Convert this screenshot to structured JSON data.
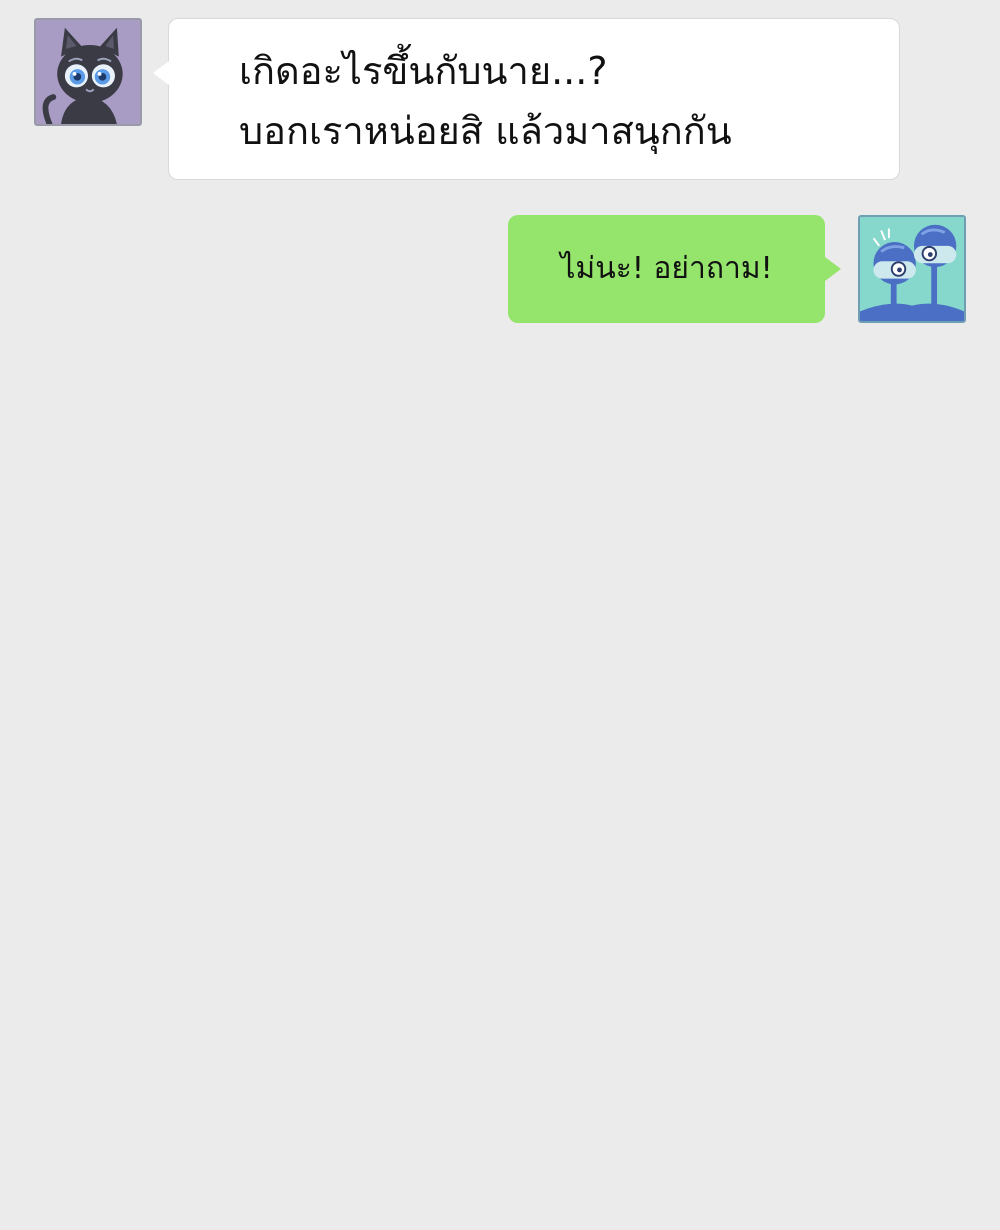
{
  "conversation": {
    "messages": [
      {
        "sender": "cat-avatar",
        "direction": "incoming",
        "lines": [
          "เกิดอะไรขึ้นกับนาย...?",
          "บอกเราหน่อยสิ แล้วมาสนุกกัน"
        ]
      },
      {
        "sender": "bird-avatar",
        "direction": "outgoing",
        "lines": [
          "ไม่นะ! อย่าถาม!"
        ]
      }
    ]
  },
  "colors": {
    "background": "#ebebeb",
    "incoming_bubble": "#ffffff",
    "outgoing_bubble": "#95e46c"
  }
}
